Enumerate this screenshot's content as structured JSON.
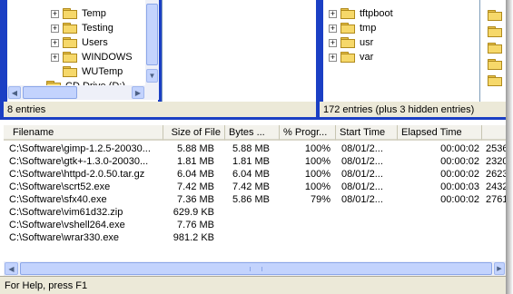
{
  "left_tree": {
    "items": [
      {
        "label": "Temp",
        "expander": "+"
      },
      {
        "label": "Testing",
        "expander": "+"
      },
      {
        "label": "Users",
        "expander": "+"
      },
      {
        "label": "WINDOWS",
        "expander": "+"
      },
      {
        "label": "WUTemp",
        "expander": ""
      },
      {
        "label": "CD Drive (D:)",
        "expander": ""
      }
    ],
    "status": "8 entries"
  },
  "remote_tree": {
    "items": [
      {
        "label": "tftpboot",
        "expander": "+"
      },
      {
        "label": "tmp",
        "expander": "+"
      },
      {
        "label": "usr",
        "expander": "+"
      },
      {
        "label": "var",
        "expander": "+"
      }
    ],
    "status": "172 entries (plus 3 hidden entries)"
  },
  "queue": {
    "columns": [
      "Filename",
      "Size of File",
      "Bytes ...",
      "% Progr...",
      "Start Time",
      "Elapsed Time",
      ""
    ],
    "rows": [
      {
        "filename": "C:\\Software\\gimp-1.2.5-20030...",
        "size": "5.88 MB",
        "bytes": "5.88 MB",
        "progress": "100%",
        "start": "08/01/2...",
        "elapsed": "00:00:02",
        "extra": "2536"
      },
      {
        "filename": "C:\\Software\\gtk+-1.3.0-20030...",
        "size": "1.81 MB",
        "bytes": "1.81 MB",
        "progress": "100%",
        "start": "08/01/2...",
        "elapsed": "00:00:02",
        "extra": "2320"
      },
      {
        "filename": "C:\\Software\\httpd-2.0.50.tar.gz",
        "size": "6.04 MB",
        "bytes": "6.04 MB",
        "progress": "100%",
        "start": "08/01/2...",
        "elapsed": "00:00:02",
        "extra": "2623"
      },
      {
        "filename": "C:\\Software\\scrt52.exe",
        "size": "7.42 MB",
        "bytes": "7.42 MB",
        "progress": "100%",
        "start": "08/01/2...",
        "elapsed": "00:00:03",
        "extra": "2432"
      },
      {
        "filename": "C:\\Software\\sfx40.exe",
        "size": "7.36 MB",
        "bytes": "5.86 MB",
        "progress": "79%",
        "start": "08/01/2...",
        "elapsed": "00:00:02",
        "extra": "2761"
      },
      {
        "filename": "C:\\Software\\vim61d32.zip",
        "size": "629.9 KB",
        "bytes": "",
        "progress": "",
        "start": "",
        "elapsed": "",
        "extra": ""
      },
      {
        "filename": "C:\\Software\\vshell264.exe",
        "size": "7.76 MB",
        "bytes": "",
        "progress": "",
        "start": "",
        "elapsed": "",
        "extra": ""
      },
      {
        "filename": "C:\\Software\\wrar330.exe",
        "size": "981.2 KB",
        "bytes": "",
        "progress": "",
        "start": "",
        "elapsed": "",
        "extra": ""
      }
    ]
  },
  "statusbar": {
    "text": "For Help, press F1"
  },
  "colors": {
    "pane_focus_border": "#1b3fc4",
    "status_bg": "#ece9d8",
    "scroll_bg": "#c3d3fd"
  }
}
